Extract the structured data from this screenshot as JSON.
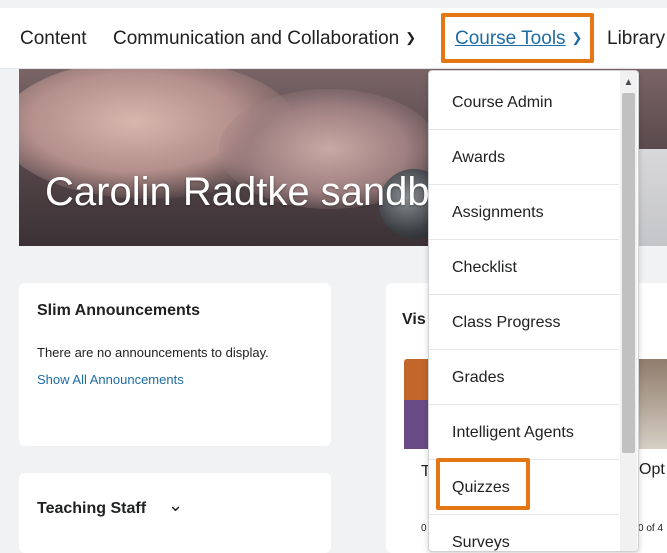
{
  "nav": {
    "content": "Content",
    "communication": "Communication and Collaboration",
    "course_tools": "Course Tools",
    "library": "Library"
  },
  "banner": {
    "title": "Carolin Radtke sandbox"
  },
  "announcements": {
    "title": "Slim Announcements",
    "empty_text": "There are no announcements to display.",
    "show_all": "Show All Announcements"
  },
  "teaching_staff": {
    "title": "Teaching Staff"
  },
  "visible_widget": {
    "title_fragment": "Vis",
    "tile1_fragment": "T",
    "tile2_fragment": "Opt",
    "tile1_progress": "0",
    "tile2_progress": "0 of 4"
  },
  "dropdown": {
    "items": [
      "Course Admin",
      "Awards",
      "Assignments",
      "Checklist",
      "Class Progress",
      "Grades",
      "Intelligent Agents",
      "Quizzes",
      "Surveys"
    ]
  },
  "colors": {
    "highlight": "#e57614",
    "link": "#1e6ca4"
  }
}
